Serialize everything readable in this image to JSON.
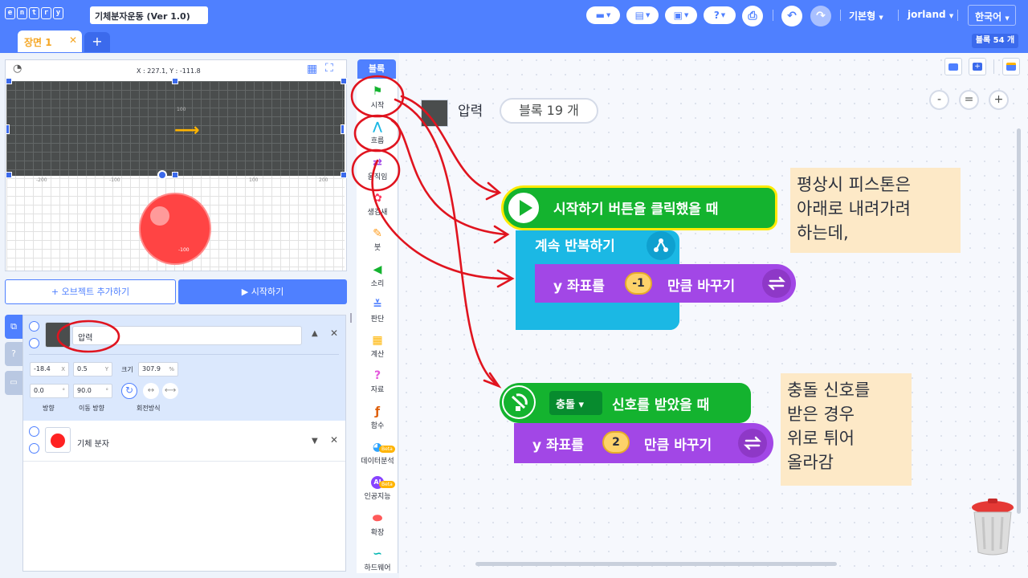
{
  "header": {
    "logo_letters": [
      "e",
      "n",
      "t",
      "r",
      "y"
    ],
    "project_title": "기체분자운동 (Ver 1.0)",
    "mode_label": "기본형",
    "user_label": "jorland",
    "language_label": "한국어",
    "help_label": "?"
  },
  "scene_tabs": {
    "scene_label": "장면 1",
    "close": "✕",
    "add": "+",
    "block_count": "블록 54 개"
  },
  "stage": {
    "coords_label": "X : 227.1,  Y : -111.8",
    "tick_labels": [
      "-200",
      "-100",
      "100",
      "200",
      "100",
      "-100"
    ],
    "add_object_label": "+ 오브젝트 추가하기",
    "start_label": "▶ 시작하기"
  },
  "object_panel": {
    "objects": [
      {
        "name": "압력",
        "x": "-18.4",
        "x_unit": "X",
        "y": "0.5",
        "y_unit": "Y",
        "size_label": "크기",
        "size": "307.9",
        "size_unit": "%",
        "direction": "0.0",
        "direction_unit": "°",
        "move_direction": "90.0",
        "move_direction_unit": "°",
        "direction_label": "방향",
        "move_direction_label": "이동 방향",
        "rotation_label": "회전방식"
      },
      {
        "name": "기체 분자"
      }
    ]
  },
  "categories": {
    "tab_label": "블록",
    "items": [
      {
        "label": "시작",
        "icon": "flag-icon",
        "color": "#14b32f"
      },
      {
        "label": "흐름",
        "icon": "flow-icon",
        "color": "#1bb8e4"
      },
      {
        "label": "움직임",
        "icon": "move-icon",
        "color": "#a247e6"
      },
      {
        "label": "생김새",
        "icon": "looks-icon",
        "color": "#ff3a61"
      },
      {
        "label": "붓",
        "icon": "brush-icon",
        "color": "#ff9e20"
      },
      {
        "label": "소리",
        "icon": "sound-icon",
        "color": "#14b32f"
      },
      {
        "label": "판단",
        "icon": "judgement-icon",
        "color": "#4f80ff"
      },
      {
        "label": "계산",
        "icon": "calc-icon",
        "color": "#ffb400"
      },
      {
        "label": "자료",
        "icon": "data-icon",
        "color": "#e457dc"
      },
      {
        "label": "함수",
        "icon": "function-icon",
        "color": "#de5c04"
      },
      {
        "label": "데이터분석",
        "icon": "analysis-icon",
        "color": "#2ea4ff",
        "badge": "Beta"
      },
      {
        "label": "인공지능",
        "icon": "ai-icon",
        "color": "#8844ff",
        "badge": "Beta"
      },
      {
        "label": "확장",
        "icon": "extension-icon",
        "color": "#ff5a5a"
      },
      {
        "label": "하드웨어",
        "icon": "hardware-icon",
        "color": "#00b6b1"
      }
    ]
  },
  "workspace": {
    "object_name": "압력",
    "block_count": "블록 19 개",
    "zoom": [
      "-",
      "=",
      "+"
    ],
    "blocks": {
      "when_start": "시작하기 버튼을 클릭했을 때",
      "repeat_forever": "계속 반복하기",
      "change_y_1_prefix": "y 좌표를",
      "change_y_1_value": "-1",
      "change_y_1_suffix": "만큼 바꾸기",
      "when_signal_option": "충돌",
      "when_signal_suffix": "신호를 받았을 때",
      "change_y_2_prefix": "y 좌표를",
      "change_y_2_value": "2",
      "change_y_2_suffix": "만큼 바꾸기"
    },
    "notes": [
      [
        "평상시 피스톤은",
        "아래로 내려가려",
        "하는데,"
      ],
      [
        "충돌 신호를",
        "받은 경우",
        "위로 튀어",
        "올라감"
      ]
    ]
  },
  "colors": {
    "brand": "#4f80ff",
    "start_green": "#14b32f",
    "flow_blue": "#1bb8e4",
    "move_purple": "#a247e6",
    "annotation_red": "#e0141f",
    "note_bg": "#fde9c7"
  }
}
